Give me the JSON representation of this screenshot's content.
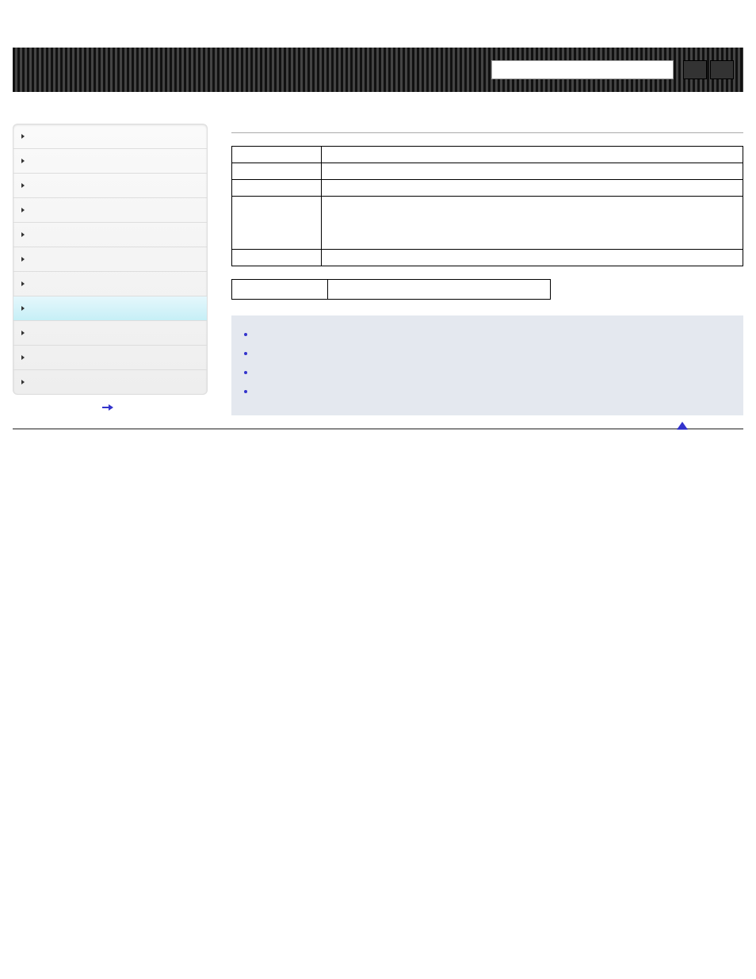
{
  "topbar": {
    "search_placeholder": "",
    "search_button": "",
    "reset_button": ""
  },
  "sidebar": {
    "items": [
      {
        "label": ""
      },
      {
        "label": ""
      },
      {
        "label": ""
      },
      {
        "label": ""
      },
      {
        "label": ""
      },
      {
        "label": ""
      },
      {
        "label": ""
      },
      {
        "label": "",
        "active": true
      },
      {
        "label": ""
      },
      {
        "label": ""
      },
      {
        "label": ""
      }
    ],
    "footer_link": ""
  },
  "breadcrumb": "",
  "page_title": "",
  "section_heading": "",
  "intro1": "",
  "intro2": "",
  "info_table_heading": "",
  "info_table": [
    {
      "label": "",
      "value": ""
    },
    {
      "label": "",
      "value": ""
    },
    {
      "label": "",
      "value": ""
    },
    {
      "label": "",
      "value": ""
    },
    {
      "label": "",
      "value": ""
    }
  ],
  "arguments_heading": "",
  "arguments_intro": "",
  "arguments_table": [
    {
      "label": "",
      "value": ""
    }
  ],
  "related": {
    "title": "",
    "items": [
      "",
      "",
      "",
      ""
    ]
  },
  "to_top_label": ""
}
